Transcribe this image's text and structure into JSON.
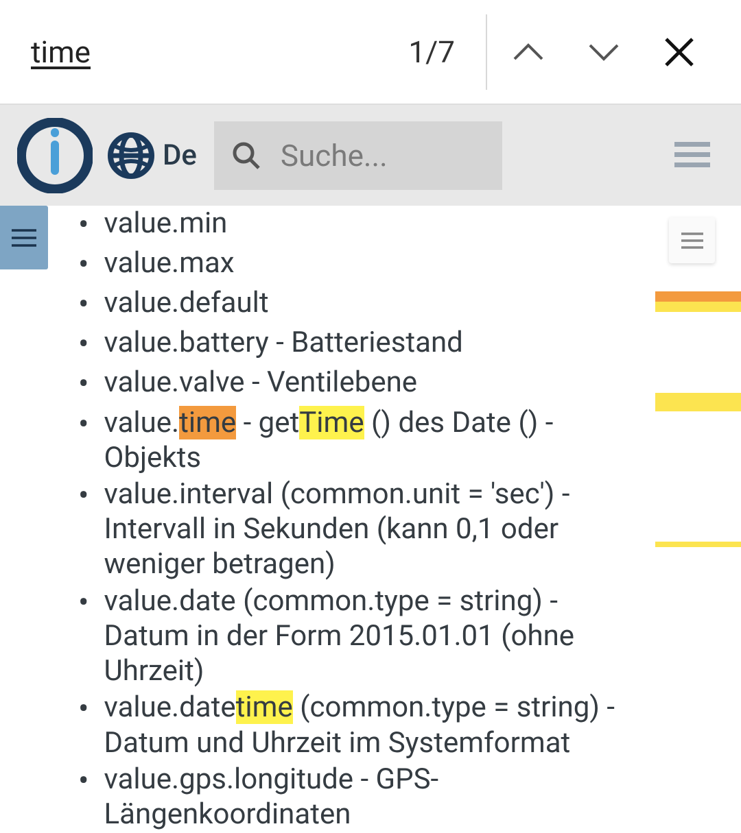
{
  "find": {
    "query": "time",
    "count": "1/7"
  },
  "lang": {
    "label": "De"
  },
  "search": {
    "placeholder": "Suche..."
  },
  "list": {
    "i0": "value.min",
    "i1": "value.max",
    "i2": "value.default",
    "i3": "value.battery - Batteriestand",
    "i4": "value.valve - Ventilebene",
    "i5_a": "value.",
    "i5_hl1": "time",
    "i5_b": " - get",
    "i5_hl2": "Time",
    "i5_c": " () des Date () - Objekts",
    "i6": "value.interval (common.unit = 'sec') - Intervall in Sekunden (kann 0,1 oder weniger betragen)",
    "i7": "value.date (common.type = string) - Datum in der Form 2015.01.01 (ohne Uhrzeit)",
    "i8_a": "value.date",
    "i8_hl": "time",
    "i8_b": " (common.type = string) - Datum und Uhrzeit im Systemformat",
    "i9": "value.gps.longitude - GPS-Längenkoordinaten"
  }
}
